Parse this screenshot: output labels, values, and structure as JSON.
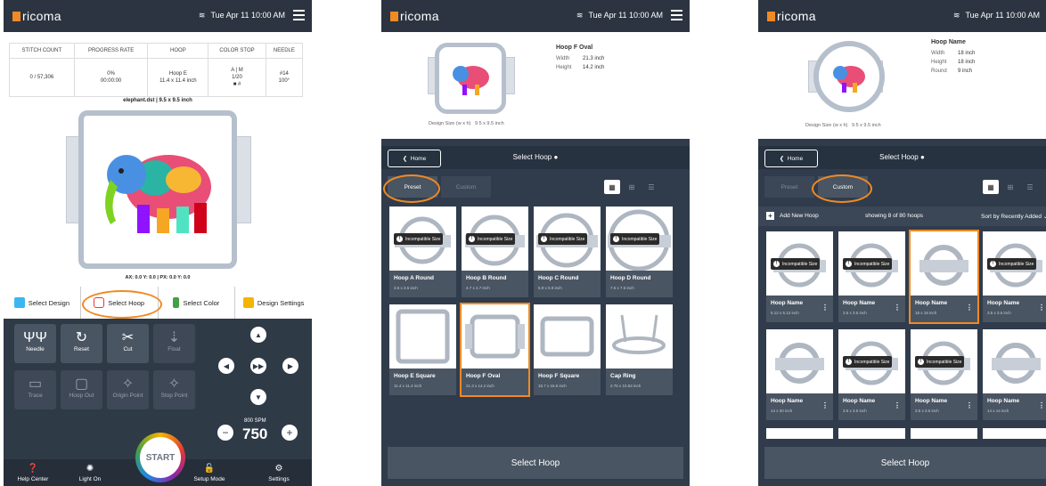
{
  "colors": {
    "accent": "#f08a24",
    "panel": "#303c4b",
    "topbar": "#2b3440"
  },
  "status": {
    "brand": "ricoma",
    "wifi_icon": "wifi-icon",
    "datetime": "Tue Apr 11  10:00 AM"
  },
  "screen1": {
    "stats_headers": [
      "STITCH COUNT",
      "PROGRESS RATE",
      "HOOP",
      "COLOR STOP",
      "NEEDLE"
    ],
    "stitch_count": "0 / 57,306",
    "progress_pct": "0%",
    "progress_time": "00:00:00",
    "hoop_name": "Hoop E",
    "hoop_size": "11.4 x 11.4 inch",
    "color_stop_code": "A | M",
    "color_stop_count": "1/20",
    "color_stop_swatch": "■ #",
    "needle_num": "#14",
    "needle_angle": "100°",
    "file_caption": "elephant.dst  |  9.5 x 9.5 inch",
    "coords": "AX: 0.0  Y: 0.0  |  PX: 0.0  Y: 0.0",
    "tabs": [
      "Select Design",
      "Select Hoop",
      "Select Color",
      "Design Settings"
    ],
    "tools": [
      "Needle",
      "Reset",
      "Cut",
      "Float",
      "Trace",
      "Hoop Out",
      "Origin Point",
      "Stop Point"
    ],
    "spm_label": "800 SPM",
    "spm_value": "750",
    "start": "START",
    "nav": [
      "Help Center",
      "Light On",
      "Setup Mode",
      "Settings"
    ]
  },
  "screen2": {
    "hoop_title": "Hoop F Oval",
    "width_label": "Width",
    "width_value": "21.3 inch",
    "height_label": "Height",
    "height_value": "14.2 inch",
    "design_size_label": "Design Size (w x h)",
    "design_size_value": "9.5 x 9.5 inch",
    "home": "Home",
    "header_title": "Select Hoop",
    "seg_preset": "Preset",
    "seg_custom": "Custom",
    "incompatible": "Incompatible Size",
    "cards": [
      {
        "name": "Hoop A Round",
        "size": "3.5 x 3.5 inch"
      },
      {
        "name": "Hoop B Round",
        "size": "4.7 x 4.7 inch"
      },
      {
        "name": "Hoop C Round",
        "size": "5.9 x 5.9 inch"
      },
      {
        "name": "Hoop D Round",
        "size": "7.5 x 7.5 inch"
      },
      {
        "name": "Hoop E Square",
        "size": "11.4 x 11.4 inch"
      },
      {
        "name": "Hoop F Oval",
        "size": "21.3 x 14.2 inch"
      },
      {
        "name": "Hoop F Square",
        "size": "15.7 x 16.5 inch"
      },
      {
        "name": "Cap Ring",
        "size": "2.76 x 10.63 inch"
      }
    ],
    "select_button": "Select Hoop"
  },
  "screen3": {
    "hoop_title": "Hoop Name",
    "width_label": "Width",
    "width_value": "18 inch",
    "height_label": "Height",
    "height_value": "18 inch",
    "round_label": "Round",
    "round_value": "9 inch",
    "design_size_label": "Design Size (w x h)",
    "design_size_value": "9.5 x 9.5 inch",
    "home": "Home",
    "header_title": "Select Hoop",
    "seg_preset": "Preset",
    "seg_custom": "Custom",
    "add_new": "Add New Hoop",
    "showing": "showing 8 of 80 hoops",
    "sort_label": "Sort by",
    "sort_value": "Recently Added",
    "incompatible": "Incompatible Size",
    "cards": [
      {
        "name": "Hoop Name",
        "size": "5.12 x 5.12 inch"
      },
      {
        "name": "Hoop Name",
        "size": "3.5 x 3.5 inch"
      },
      {
        "name": "Hoop Name",
        "size": "18 x 18 inch"
      },
      {
        "name": "Hoop Name",
        "size": "3.5 x 3.5 inch"
      },
      {
        "name": "Hoop Name",
        "size": "14 x 20 inch"
      },
      {
        "name": "Hoop Name",
        "size": "3.5 x 3.5 inch"
      },
      {
        "name": "Hoop Name",
        "size": "3.5 x 3.5 inch"
      },
      {
        "name": "Hoop Name",
        "size": "14 x 14 inch"
      }
    ],
    "select_button": "Select Hoop"
  }
}
